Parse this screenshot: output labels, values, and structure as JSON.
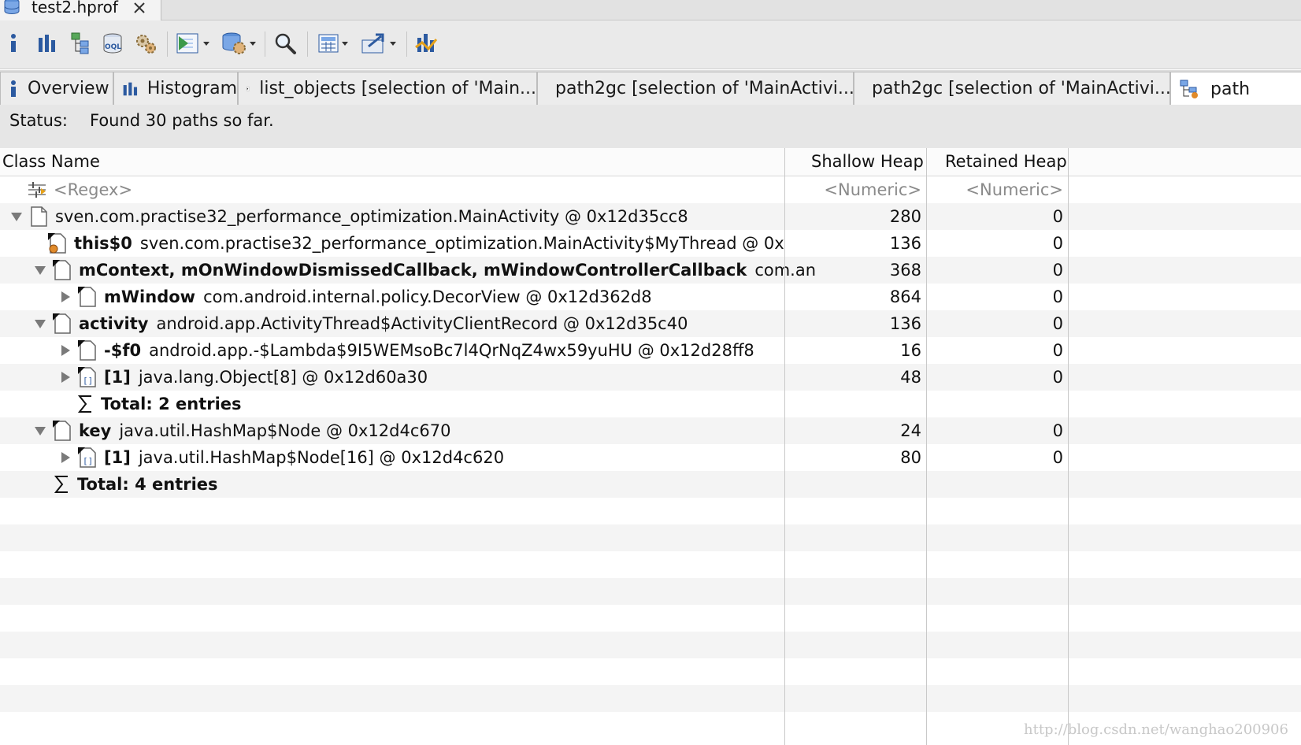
{
  "editor_tab": {
    "title": "test2.hprof"
  },
  "result_tabs": [
    {
      "label": "Overview"
    },
    {
      "label": "Histogram"
    },
    {
      "label": "list_objects [selection of 'Main..."
    },
    {
      "label": "path2gc [selection of 'MainActivi..."
    },
    {
      "label": "path2gc [selection of 'MainActivi..."
    },
    {
      "label": "path"
    }
  ],
  "status": {
    "key": "Status:",
    "value": "Found 30 paths so far."
  },
  "table": {
    "headers": {
      "name": "Class Name",
      "shallow": "Shallow Heap",
      "retained": "Retained Heap"
    },
    "filter": {
      "name": "<Regex>",
      "shallow": "<Numeric>",
      "retained": "<Numeric>"
    },
    "rows": [
      {
        "bold": "",
        "text": "sven.com.practise32_performance_optimization.MainActivity @ 0x12d35cc8",
        "shallow": "280",
        "retained": "0"
      },
      {
        "bold": "this$0",
        "text": "sven.com.practise32_performance_optimization.MainActivity$MyThread @ 0x",
        "shallow": "136",
        "retained": "0"
      },
      {
        "bold": "mContext, mOnWindowDismissedCallback, mWindowControllerCallback",
        "text": "com.an",
        "shallow": "368",
        "retained": "0"
      },
      {
        "bold": "mWindow",
        "text": "com.android.internal.policy.DecorView @ 0x12d362d8",
        "shallow": "864",
        "retained": "0"
      },
      {
        "bold": "activity",
        "text": "android.app.ActivityThread$ActivityClientRecord @ 0x12d35c40",
        "shallow": "136",
        "retained": "0"
      },
      {
        "bold": "-$f0",
        "text": "android.app.-$Lambda$9I5WEMsoBc7l4QrNqZ4wx59yuHU @ 0x12d28ff8",
        "shallow": "16",
        "retained": "0"
      },
      {
        "bold": "[1]",
        "text": "java.lang.Object[8] @ 0x12d60a30",
        "shallow": "48",
        "retained": "0"
      },
      {
        "bold": "Total: 2 entries",
        "text": "",
        "shallow": "",
        "retained": ""
      },
      {
        "bold": "key",
        "text": "java.util.HashMap$Node @ 0x12d4c670",
        "shallow": "24",
        "retained": "0"
      },
      {
        "bold": "[1]",
        "text": "java.util.HashMap$Node[16] @ 0x12d4c620",
        "shallow": "80",
        "retained": "0"
      },
      {
        "bold": "Total: 4 entries",
        "text": "",
        "shallow": "",
        "retained": ""
      }
    ]
  },
  "watermark": "http://blog.csdn.net/wanghao200906",
  "colors": {
    "icon_blue": "#2c5aa0",
    "icon_orange": "#e08a2a",
    "row_alt": "#f4f4f4",
    "toolbar_bg": "#eaeaea"
  }
}
